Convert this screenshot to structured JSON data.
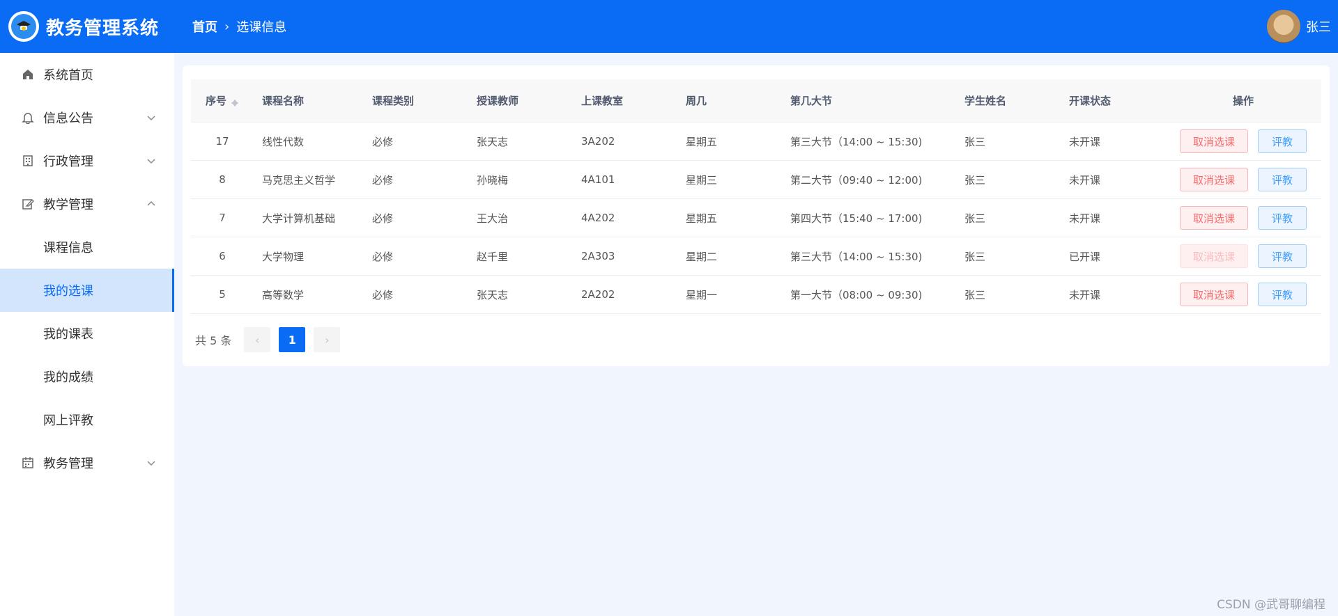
{
  "app": {
    "title": "教务管理系统"
  },
  "breadcrumb": {
    "home": "首页",
    "current": "选课信息"
  },
  "user": {
    "name": "张三"
  },
  "sidebar": {
    "items": [
      {
        "label": "系统首页",
        "icon": "home-icon"
      },
      {
        "label": "信息公告",
        "icon": "bell-icon",
        "expandable": true
      },
      {
        "label": "行政管理",
        "icon": "building-icon",
        "expandable": true
      },
      {
        "label": "教学管理",
        "icon": "edit-icon",
        "expandable": true,
        "expanded": true,
        "children": [
          {
            "label": "课程信息"
          },
          {
            "label": "我的选课",
            "active": true
          },
          {
            "label": "我的课表"
          },
          {
            "label": "我的成绩"
          },
          {
            "label": "网上评教"
          }
        ]
      },
      {
        "label": "教务管理",
        "icon": "calendar-icon",
        "expandable": true
      }
    ]
  },
  "table": {
    "headers": {
      "no": "序号",
      "name": "课程名称",
      "type": "课程类别",
      "teacher": "授课教师",
      "room": "上课教室",
      "week": "周几",
      "period": "第几大节",
      "student": "学生姓名",
      "status": "开课状态",
      "ops": "操作"
    },
    "rows": [
      {
        "no": "17",
        "name": "线性代数",
        "type": "必修",
        "teacher": "张天志",
        "room": "3A202",
        "week": "星期五",
        "period": "第三大节（14:00 ~ 15:30)",
        "student": "张三",
        "status": "未开课",
        "cancel": "取消选课",
        "eval": "评教",
        "cancel_disabled": false
      },
      {
        "no": "8",
        "name": "马克思主义哲学",
        "type": "必修",
        "teacher": "孙晓梅",
        "room": "4A101",
        "week": "星期三",
        "period": "第二大节（09:40 ~ 12:00)",
        "student": "张三",
        "status": "未开课",
        "cancel": "取消选课",
        "eval": "评教",
        "cancel_disabled": false
      },
      {
        "no": "7",
        "name": "大学计算机基础",
        "type": "必修",
        "teacher": "王大治",
        "room": "4A202",
        "week": "星期五",
        "period": "第四大节（15:40 ~ 17:00)",
        "student": "张三",
        "status": "未开课",
        "cancel": "取消选课",
        "eval": "评教",
        "cancel_disabled": false
      },
      {
        "no": "6",
        "name": "大学物理",
        "type": "必修",
        "teacher": "赵千里",
        "room": "2A303",
        "week": "星期二",
        "period": "第三大节（14:00 ~ 15:30)",
        "student": "张三",
        "status": "已开课",
        "cancel": "取消选课",
        "eval": "评教",
        "cancel_disabled": true
      },
      {
        "no": "5",
        "name": "高等数学",
        "type": "必修",
        "teacher": "张天志",
        "room": "2A202",
        "week": "星期一",
        "period": "第一大节（08:00 ~ 09:30)",
        "student": "张三",
        "status": "未开课",
        "cancel": "取消选课",
        "eval": "评教",
        "cancel_disabled": false
      }
    ]
  },
  "pagination": {
    "total": "共 5 条",
    "current_page": "1",
    "prev": "‹",
    "next": "›"
  },
  "watermark": "CSDN @武哥聊编程",
  "colors": {
    "primary": "#0a6cf5",
    "danger": "#f56c6c",
    "info": "#409eff",
    "background": "#f1f5fd"
  }
}
